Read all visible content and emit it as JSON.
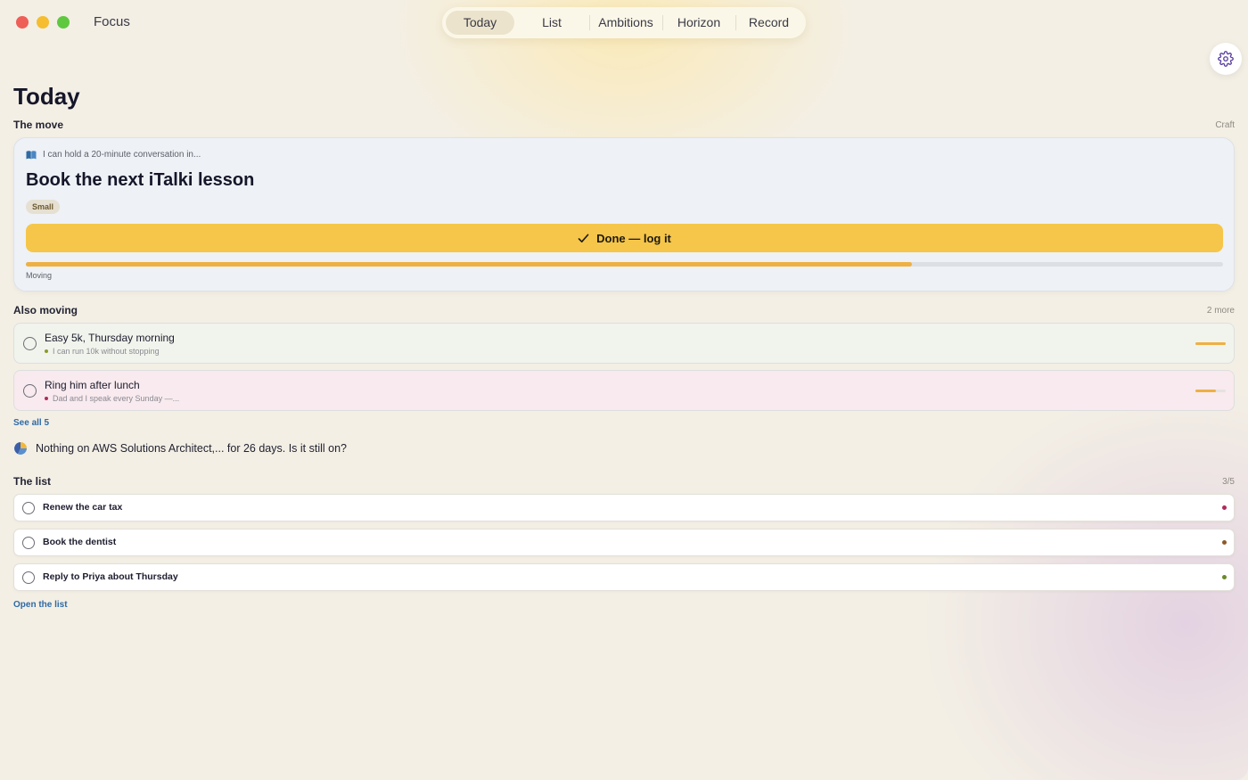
{
  "app": {
    "title": "Focus"
  },
  "nav": {
    "tabs": [
      {
        "label": "Today",
        "active": true
      },
      {
        "label": "List",
        "active": false
      },
      {
        "label": "Ambitions",
        "active": false
      },
      {
        "label": "Horizon",
        "active": false
      },
      {
        "label": "Record",
        "active": false
      }
    ],
    "settings_icon": "gear-icon"
  },
  "page": {
    "title": "Today"
  },
  "move": {
    "section_label": "The move",
    "section_meta": "Craft",
    "ambition": "I can hold a 20-minute conversation in...",
    "ambition_icon": "book-icon",
    "title": "Book the next iTalki lesson",
    "size_chip": "Small",
    "done_label": "Done — log it",
    "progress": 0.74,
    "status": "Moving",
    "accent": "#f5c64a"
  },
  "also_moving": {
    "section_label": "Also moving",
    "section_meta": "2 more",
    "items": [
      {
        "name": "Easy 5k, Thursday morning",
        "ambition": "I can run 10k without stopping",
        "dot_color": "#8c9a2a",
        "bg": "#f1f4ec",
        "progress": 1.0
      },
      {
        "name": "Ring him after lunch",
        "ambition": "Dad and I speak every Sunday —...",
        "dot_color": "#b02a5a",
        "bg": "#f8eaee",
        "progress": 0.68
      }
    ],
    "see_all": "See all 5"
  },
  "nudge": {
    "icon": "pie-chart-icon",
    "text": "Nothing on AWS Solutions Architect,... for 26 days. Is it still on?"
  },
  "list": {
    "section_label": "The list",
    "section_meta": "3/5",
    "items": [
      {
        "name": "Renew the car tax",
        "dot_color": "#b02a5a"
      },
      {
        "name": "Book the dentist",
        "dot_color": "#8c5a2a"
      },
      {
        "name": "Reply to Priya about Thursday",
        "dot_color": "#6a8a2a"
      }
    ],
    "open_link": "Open the list"
  }
}
